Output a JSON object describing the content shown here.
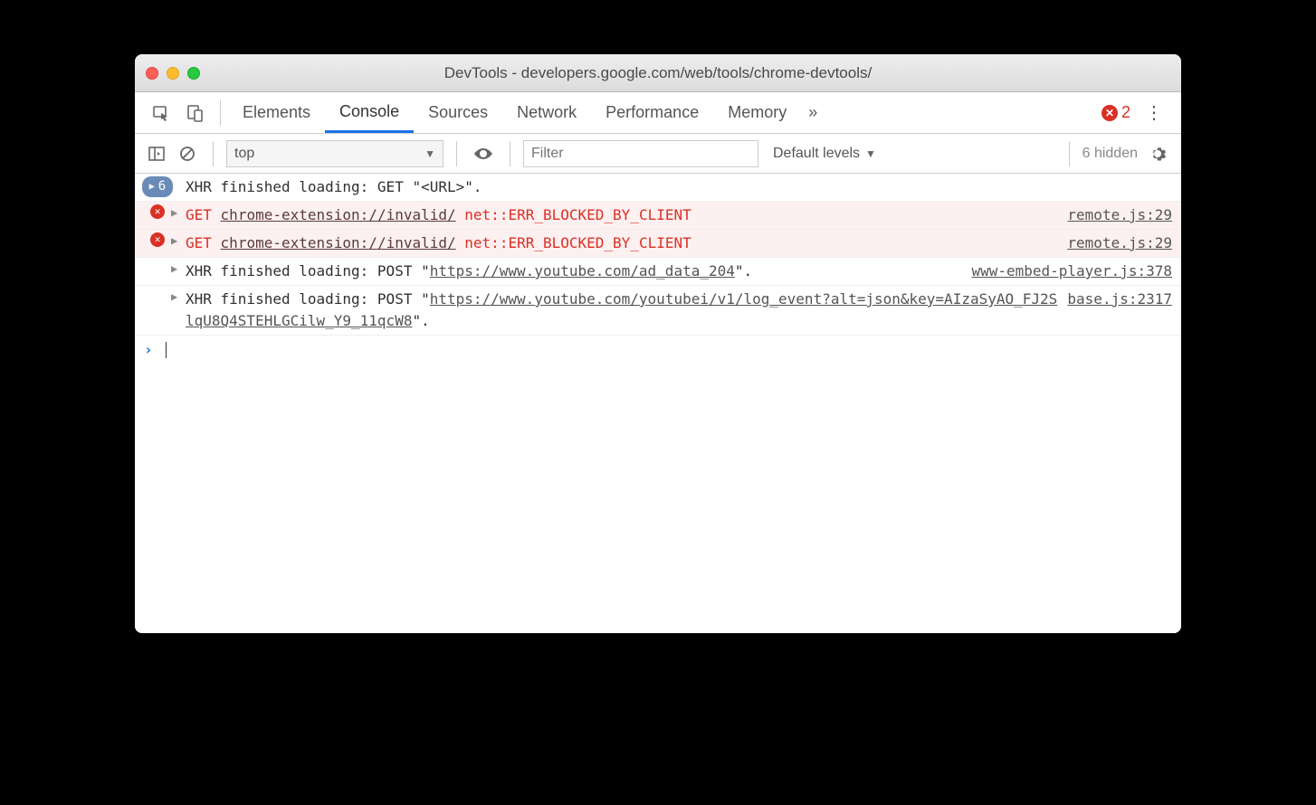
{
  "window": {
    "title": "DevTools - developers.google.com/web/tools/chrome-devtools/"
  },
  "tabs": {
    "items": [
      "Elements",
      "Console",
      "Sources",
      "Network",
      "Performance",
      "Memory"
    ],
    "active": 1,
    "overflow_icon": "»",
    "error_count": "2"
  },
  "toolbar": {
    "context": "top",
    "filter_placeholder": "Filter",
    "levels": "Default levels",
    "hidden": "6 hidden"
  },
  "log": {
    "group_count": "6",
    "group_text": "XHR finished loading: GET \"<URL>\".",
    "err1": {
      "method": "GET",
      "url": "chrome-extension://invalid/",
      "msg": "net::ERR_BLOCKED_BY_CLIENT",
      "src": "remote.js:29"
    },
    "err2": {
      "method": "GET",
      "url": "chrome-extension://invalid/",
      "msg": "net::ERR_BLOCKED_BY_CLIENT",
      "src": "remote.js:29"
    },
    "xhr1": {
      "prefix": "XHR finished loading: POST \"",
      "url": "https://www.youtube.com/ad_data_204",
      "suffix": "\".",
      "src": "www-embed-player.js:378"
    },
    "xhr2": {
      "prefix": "XHR finished loading: POST \"",
      "url": "https://www.youtube.com/youtubei/v1/log_event?alt=json&key=AIzaSyAO_FJ2SlqU8Q4STEHLGCilw_Y9_11qcW8",
      "suffix": "\".",
      "src": "base.js:2317"
    }
  }
}
